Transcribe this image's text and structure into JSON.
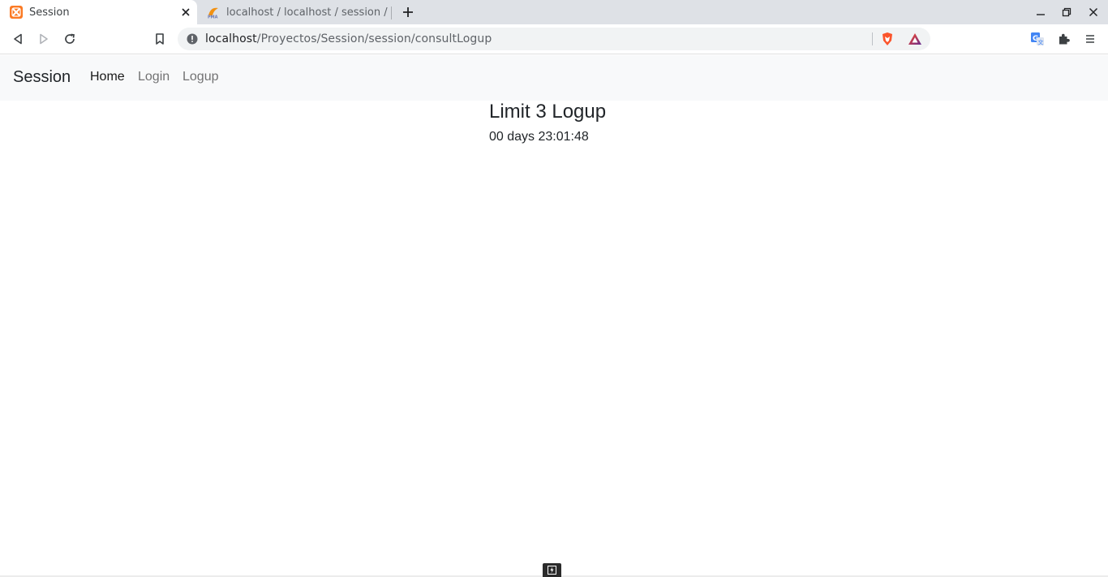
{
  "browser": {
    "tabs": [
      {
        "title": "Session",
        "favicon": "xampp-icon",
        "active": true
      },
      {
        "title": "localhost / localhost / session / ",
        "favicon": "phpmyadmin-icon",
        "active": false
      }
    ],
    "url_host": "localhost",
    "url_path": "/Proyectos/Session/session/consultLogup"
  },
  "navbar": {
    "brand": "Session",
    "links": [
      {
        "label": "Home",
        "active": true
      },
      {
        "label": "Login",
        "active": false
      },
      {
        "label": "Logup",
        "active": false
      }
    ]
  },
  "main": {
    "heading": "Limit 3 Logup",
    "countdown": "00 days 23:01:48"
  },
  "colors": {
    "xampp_orange": "#fb7a24",
    "brave_orange": "#fb542b",
    "navbar_bg": "#f8f9fa",
    "translate_blue": "#4285f4"
  }
}
